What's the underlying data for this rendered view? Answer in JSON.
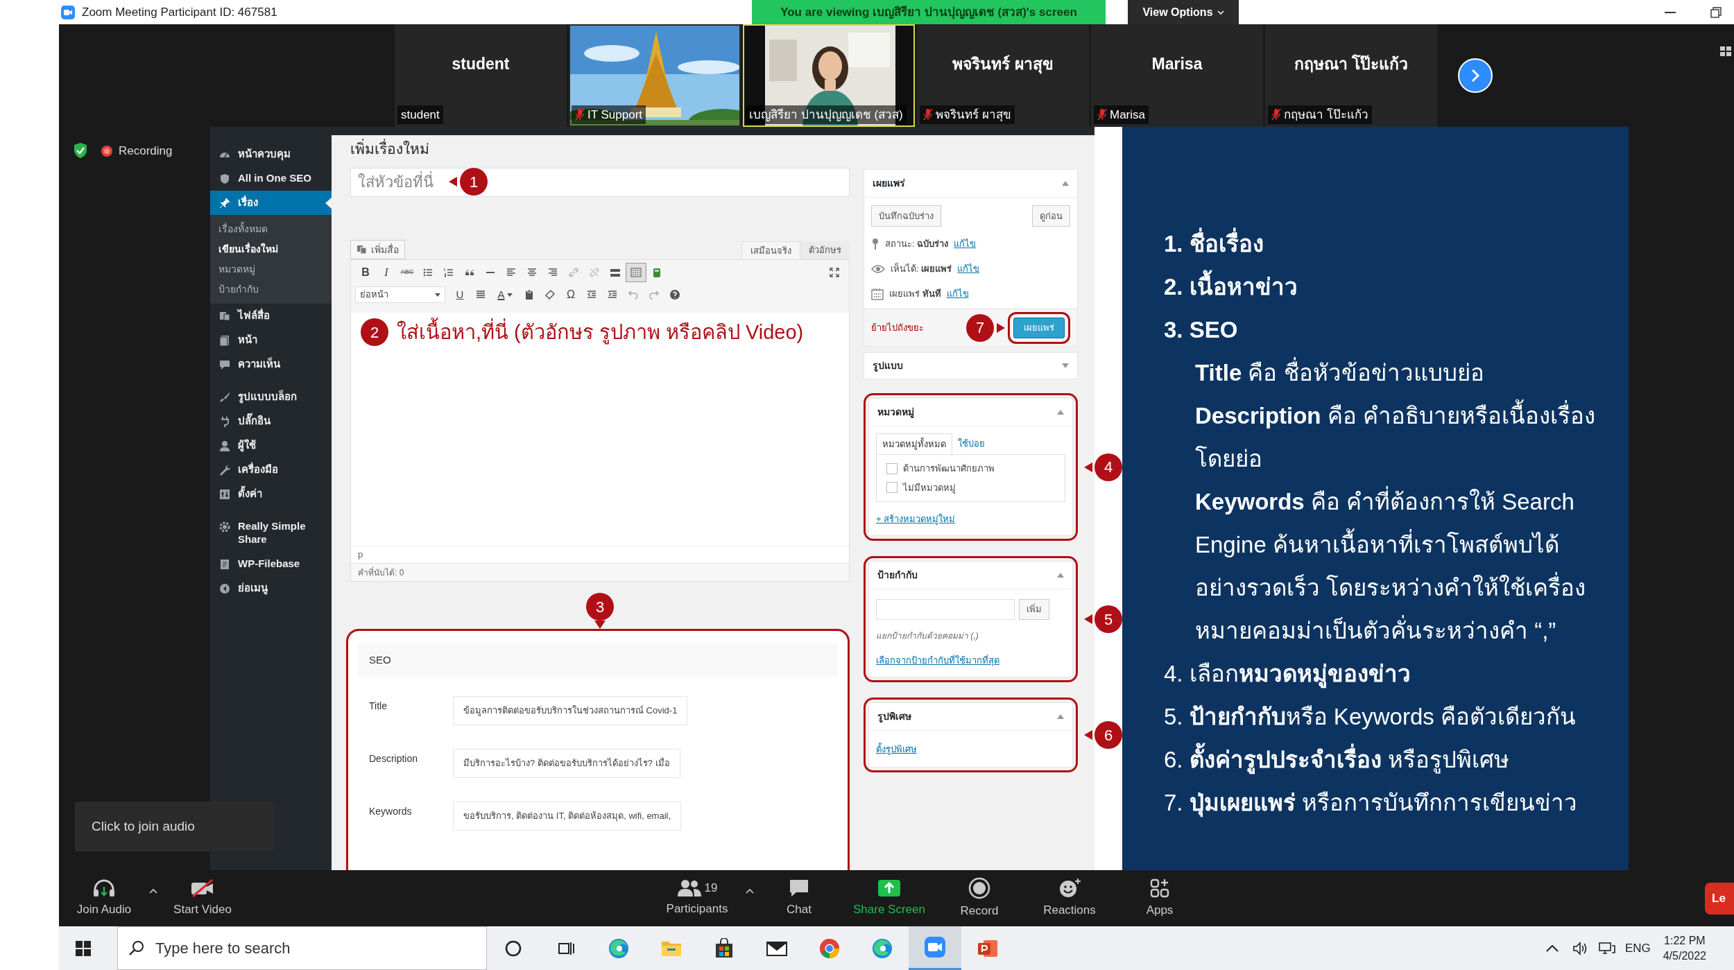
{
  "window": {
    "title": "Zoom Meeting Participant ID: 467581"
  },
  "share_banner": {
    "text": "You are viewing เบญสิรียา ปานปุญญเดช (สวส)'s screen",
    "view_options": "View Options"
  },
  "participants": [
    {
      "kind": "name",
      "name": "student",
      "label": "student",
      "muted": false,
      "speaking": false
    },
    {
      "kind": "picture",
      "label": "IT Support",
      "muted": true,
      "speaking": false
    },
    {
      "kind": "picture",
      "label": "เบญสิรียา ปานปุญญเดช (สวส)",
      "muted": false,
      "speaking": true
    },
    {
      "kind": "name",
      "name": "พจรินทร์ ผาสุข",
      "label": "พจรินทร์ ผาสุข",
      "muted": true,
      "speaking": false
    },
    {
      "kind": "name",
      "name": "Marisa",
      "label": "Marisa",
      "muted": true,
      "speaking": false
    },
    {
      "kind": "name",
      "name": "กฤษณา โป๊ะแก้ว",
      "label": "กฤษณา โป๊ะแก้ว",
      "muted": true,
      "speaking": false
    }
  ],
  "recording": {
    "label": "Recording"
  },
  "sidebar": {
    "groups": [
      [
        {
          "label": "หน้าควบคุม",
          "selected": false
        },
        {
          "label": "All in One SEO",
          "selected": false
        },
        {
          "label": "เรื่อง",
          "selected": true,
          "children": [
            {
              "label": "เรื่องทั้งหมด",
              "selected": false
            },
            {
              "label": "เขียนเรื่องใหม่",
              "selected": true
            },
            {
              "label": "หมวดหมู่",
              "selected": false
            },
            {
              "label": "ป้ายกำกับ",
              "selected": false
            }
          ]
        },
        {
          "label": "ไฟล์สื่อ",
          "selected": false
        },
        {
          "label": "หน้า",
          "selected": false
        },
        {
          "label": "ความเห็น",
          "selected": false
        }
      ],
      [
        {
          "label": "รูปแบบบล็อก",
          "selected": false
        },
        {
          "label": "ปลั๊กอิน",
          "selected": false
        },
        {
          "label": "ผู้ใช้",
          "selected": false
        },
        {
          "label": "เครื่องมือ",
          "selected": false
        },
        {
          "label": "ตั้งค่า",
          "selected": false
        }
      ],
      [
        {
          "label": "Really Simple Share",
          "selected": false
        },
        {
          "label": "WP-Filebase",
          "selected": false
        },
        {
          "label": "ย่อเมนู",
          "selected": false
        }
      ]
    ]
  },
  "page_title": "เพิ่มเรื่องใหม่",
  "title_field": {
    "placeholder": "ใส่หัวข้อที่นี่",
    "marker": "1"
  },
  "editor": {
    "add_media": "เพิ่มสื่อ",
    "tabs": [
      {
        "label": "เสมือนจริง",
        "selected": true
      },
      {
        "label": "ตัวอักษร",
        "selected": false
      }
    ],
    "glyphs": {
      "bold": "B",
      "italic": "I",
      "strike": "ABC",
      "underline": "U",
      "font_color": "A",
      "special": "Ω"
    },
    "format": "ย่อหน้า",
    "toolbar_toggle_on": true,
    "note_marker": "2",
    "note": "ใส่เนื้อหา,ที่นี่ (ตัวอักษร รูปภาพ หรือคลิป Video)",
    "path": "p",
    "word_count": "คำที่นับได้: 0"
  },
  "seo": {
    "marker": "3",
    "heading": "SEO",
    "fields": [
      {
        "label": "Title",
        "value": "ข้อมูลการติดต่อขอรับบริการในช่วงสถานการณ์ Covid-1"
      },
      {
        "label": "Description",
        "value": "มีบริการอะไรบ้าง?  ติดต่อขอรับบริการได้อย่างไร?  เมื่อ"
      },
      {
        "label": "Keywords",
        "value": "ขอรับบริการ, ติดต่องาน IT, ติดต่อห้องสมุด, wifi, email,"
      }
    ]
  },
  "publish": {
    "heading": "เผยแพร่",
    "expanded": true,
    "save_draft": "บันทึกฉบับร่าง",
    "preview": "ดูก่อน",
    "rows": [
      {
        "kind": "status",
        "text": "สถานะ: **ฉบับร่าง**",
        "link": "แก้ไข"
      },
      {
        "kind": "visibility",
        "text": "เห็นได้: **เผยแพร่**",
        "link": "แก้ไข"
      },
      {
        "kind": "schedule",
        "text": "เผยแพร่ **ทันที**",
        "link": "แก้ไข"
      }
    ],
    "trash": "ย้ายไปถังขยะ",
    "marker": "7",
    "publish": "เผยแพร่"
  },
  "format_box": {
    "heading": "รูปแบบ",
    "expanded": false
  },
  "categories": {
    "heading": "หมวดหมู่",
    "expanded": true,
    "marker": "4",
    "tabs": [
      {
        "label": "หมวดหมู่ทั้งหมด",
        "selected": true
      },
      {
        "label": "ใช้บ่อย",
        "selected": false
      }
    ],
    "items": [
      {
        "label": "ด้านการพัฒนาศักยภาพ",
        "checked": false
      },
      {
        "label": "ไม่มีหมวดหมู่",
        "checked": false
      }
    ],
    "add_link": "+ สร้างหมวดหมู่ใหม่"
  },
  "tags": {
    "heading": "ป้ายกำกับ",
    "expanded": true,
    "marker": "5",
    "add_button": "เพิ่ม",
    "hint": "แยกป้ายกำกับด้วยคอมม่า (,)",
    "link": "เลือกจากป้ายกำกับที่ใช้มากที่สุด"
  },
  "featured": {
    "heading": "รูปพิเศษ",
    "expanded": true,
    "marker": "6",
    "link": "ตั้งรูปพิเศษ"
  },
  "slide": {
    "items": [
      {
        "kind": "heading",
        "text": "**1. ชื่อเรื่อง**"
      },
      {
        "kind": "heading",
        "text": "**2. เนื้อหาข่าว**"
      },
      {
        "kind": "heading",
        "text": "**3. SEO**"
      },
      {
        "kind": "sub",
        "text": "**Title** คือ ชื่อหัวข้อข่าวแบบย่อ"
      },
      {
        "kind": "sub",
        "text": "**Description** คือ คำอธิบายหรือเนื้องเรื่องโดยย่อ"
      },
      {
        "kind": "sub",
        "text": "**Keywords** คือ คำที่ต้องการให้ Search Engine ค้นหาเนื้อหาที่เราโพสต์พบได้อย่างรวดเร็ว โดยระหว่างคำให้ใช้เครื่องหมายคอมม่าเป็นตัวคั่นระหว่างคำ  “,”"
      },
      {
        "kind": "point",
        "text": "4. เลือก**หมวดหมู่ของข่าว**"
      },
      {
        "kind": "point",
        "text": "5. **ป้ายกำกับ**หรือ Keywords คือตัวเดียวกัน"
      },
      {
        "kind": "point",
        "text": "6. **ตั้งค่ารูปประจำเรื่อง** หรือรูปพิเศษ"
      },
      {
        "kind": "point",
        "text": "7. **ปุ่มเผยแพร่** หรือการบันทึกการเขียนข่าว"
      }
    ]
  },
  "tooltip": "Click to join audio",
  "toolbar": {
    "join_audio": "Join Audio",
    "start_video": "Start Video",
    "participants": "Participants",
    "participant_count": "19",
    "chat": "Chat",
    "share_screen": "Share Screen",
    "record": "Record",
    "reactions": "Reactions",
    "apps": "Apps",
    "leave": "Le"
  },
  "taskbar": {
    "search_placeholder": "Type here to search",
    "apps": [
      {
        "kind": "cortana",
        "active": false
      },
      {
        "kind": "taskview",
        "active": false
      },
      {
        "kind": "edge",
        "active": false
      },
      {
        "kind": "explorer",
        "active": false
      },
      {
        "kind": "store",
        "active": false
      },
      {
        "kind": "mail",
        "active": false
      },
      {
        "kind": "chrome",
        "active": false
      },
      {
        "kind": "edge",
        "active": false
      },
      {
        "kind": "zoom",
        "active": true
      },
      {
        "kind": "powerpoint",
        "active": false
      }
    ],
    "language": "ENG",
    "time": "1:22 PM",
    "date": "4/5/2022"
  }
}
